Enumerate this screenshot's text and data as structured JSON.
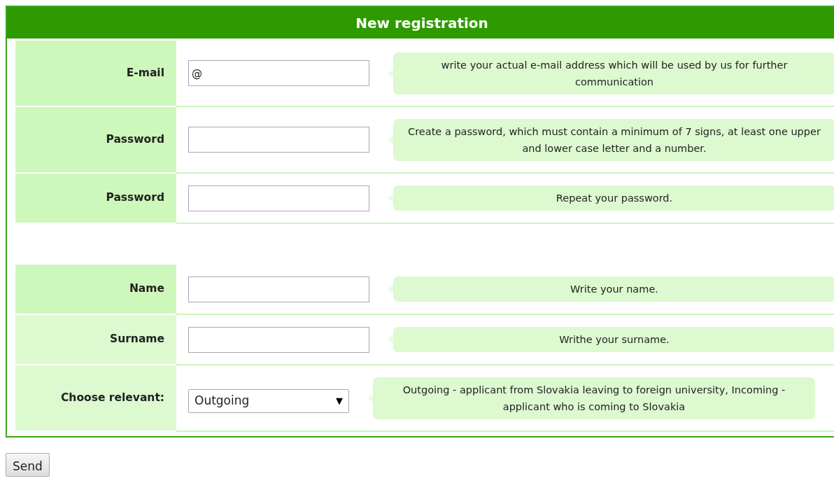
{
  "form": {
    "title": "New registration",
    "groups": [
      {
        "rows": [
          {
            "label": "E-mail",
            "kind": "text",
            "value": "@",
            "hint": "write your actual e-mail address which will be used by us for further communication",
            "highlighted": true
          },
          {
            "label": "Password",
            "kind": "text",
            "value": "",
            "hint": "Create a password, which must contain a minimum of 7 signs, at least one upper and lower case letter and a number.",
            "highlighted": true
          },
          {
            "label": "Password",
            "kind": "text",
            "value": "",
            "hint": "Repeat your password.",
            "highlighted": true
          }
        ]
      },
      {
        "rows": [
          {
            "label": "Name",
            "kind": "text",
            "value": "",
            "hint": "Write your name.",
            "highlighted": true
          },
          {
            "label": "Surname",
            "kind": "text",
            "value": "",
            "hint": "Writhe your surname.",
            "highlighted": false
          },
          {
            "label": "Choose relevant:",
            "kind": "select",
            "value": "Outgoing",
            "arrow": "▼",
            "hint": "Outgoing - applicant from Slovakia leaving to foreign university, Incoming - applicant who is coming to Slovakia",
            "highlighted": false
          }
        ]
      }
    ]
  },
  "submit": {
    "label": "Send"
  }
}
